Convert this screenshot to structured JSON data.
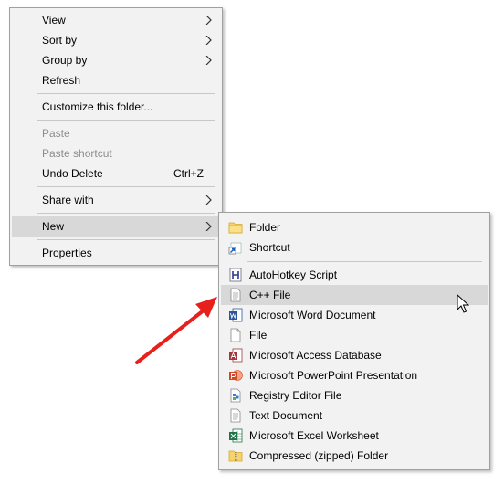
{
  "context_menu": {
    "items": [
      {
        "label": "View",
        "has_submenu": true
      },
      {
        "label": "Sort by",
        "has_submenu": true
      },
      {
        "label": "Group by",
        "has_submenu": true
      },
      {
        "label": "Refresh"
      },
      {
        "label": "Customize this folder..."
      },
      {
        "label": "Paste",
        "disabled": true
      },
      {
        "label": "Paste shortcut",
        "disabled": true
      },
      {
        "label": "Undo Delete",
        "shortcut": "Ctrl+Z"
      },
      {
        "label": "Share with",
        "has_submenu": true
      },
      {
        "label": "New",
        "has_submenu": true,
        "highlighted": true
      },
      {
        "label": "Properties"
      }
    ]
  },
  "new_submenu": {
    "items": [
      {
        "label": "Folder",
        "icon": "folder-icon"
      },
      {
        "label": "Shortcut",
        "icon": "shortcut-icon"
      },
      {
        "label": "AutoHotkey Script",
        "icon": "autohotkey-icon"
      },
      {
        "label": "C++ File",
        "icon": "text-file-icon",
        "highlighted": true
      },
      {
        "label": "Microsoft Word Document",
        "icon": "word-icon"
      },
      {
        "label": "File",
        "icon": "blank-file-icon"
      },
      {
        "label": "Microsoft Access Database",
        "icon": "access-icon"
      },
      {
        "label": "Microsoft PowerPoint Presentation",
        "icon": "powerpoint-icon"
      },
      {
        "label": "Registry Editor File",
        "icon": "registry-icon"
      },
      {
        "label": "Text Document",
        "icon": "text-document-icon"
      },
      {
        "label": "Microsoft Excel Worksheet",
        "icon": "excel-icon"
      },
      {
        "label": "Compressed (zipped) Folder",
        "icon": "zip-folder-icon"
      }
    ]
  },
  "colors": {
    "menu_bg": "#f2f2f2",
    "highlight": "#d8d8d8",
    "disabled_text": "#8d8d8d",
    "annotation_arrow": "#e8201c"
  }
}
